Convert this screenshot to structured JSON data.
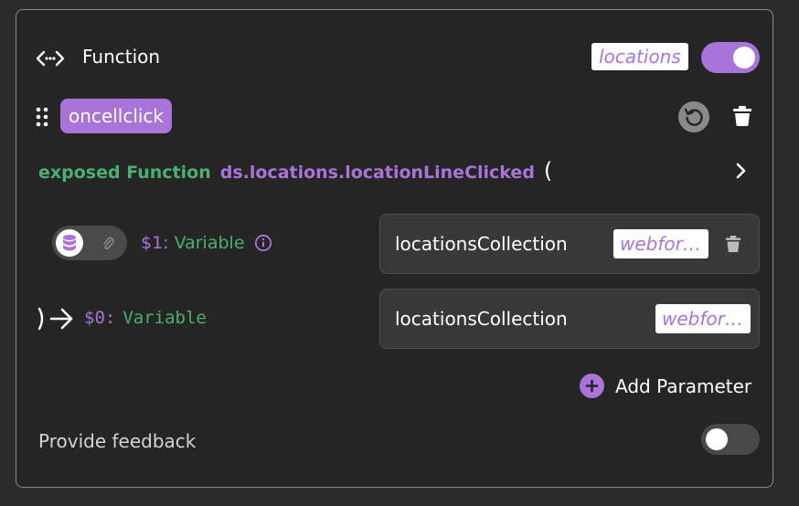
{
  "header": {
    "title": "Function",
    "source_chip": "locations",
    "enabled": true,
    "icon": "code-dots-icon"
  },
  "event": {
    "name": "oncellclick"
  },
  "signature": {
    "prefix": "exposed Function",
    "path": "ds.locations.locationLineClicked",
    "open_paren": "("
  },
  "params": [
    {
      "name": "$1:",
      "type": "Variable",
      "value": "locationsCollection",
      "source": "webfor…"
    }
  ],
  "return": {
    "name": "$0:",
    "type": "Variable",
    "value": "locationsCollection",
    "source": "webfor…"
  },
  "add_parameter_label": "Add Parameter",
  "feedback": {
    "label": "Provide feedback",
    "enabled": false
  },
  "colors": {
    "accent": "#a874d9",
    "green": "#4caf72",
    "background": "#252525"
  }
}
